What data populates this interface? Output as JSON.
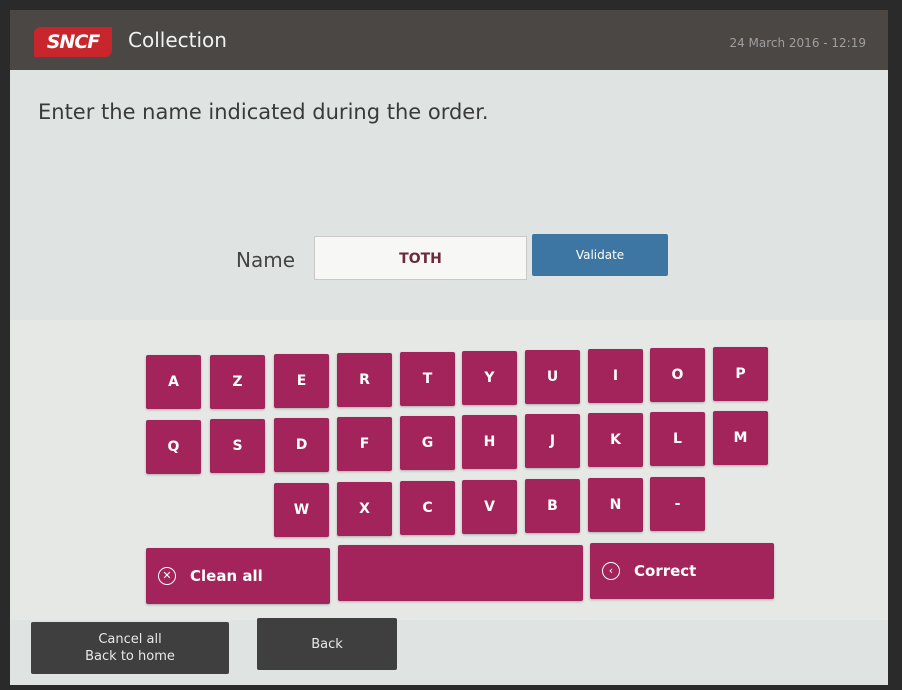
{
  "header": {
    "logo": "SNCF",
    "title": "Collection",
    "datetime": "24 March 2016 - 12:19"
  },
  "main": {
    "instruction": "Enter the name indicated during the order.",
    "name_label": "Name",
    "name_value": "TOTH",
    "validate_label": "Validate"
  },
  "keyboard": {
    "row1": [
      "A",
      "Z",
      "E",
      "R",
      "T",
      "Y",
      "U",
      "I",
      "O",
      "P"
    ],
    "row2": [
      "Q",
      "S",
      "D",
      "F",
      "G",
      "H",
      "J",
      "K",
      "L",
      "M"
    ],
    "row3": [
      "W",
      "X",
      "C",
      "V",
      "B",
      "N",
      "-"
    ],
    "clean_all_label": "Clean all",
    "space_label": "",
    "correct_label": "Correct",
    "clean_icon": "x-circle-icon",
    "correct_icon": "chevron-left-circle-icon"
  },
  "footer": {
    "cancel_line1": "Cancel all",
    "cancel_line2": "Back to home",
    "back_label": "Back"
  },
  "colors": {
    "header_bg": "#4a4745",
    "brand_red": "#c9252d",
    "key_color": "#a3245a",
    "validate_color": "#3d76a3",
    "footer_btn": "#3f3f3f"
  }
}
